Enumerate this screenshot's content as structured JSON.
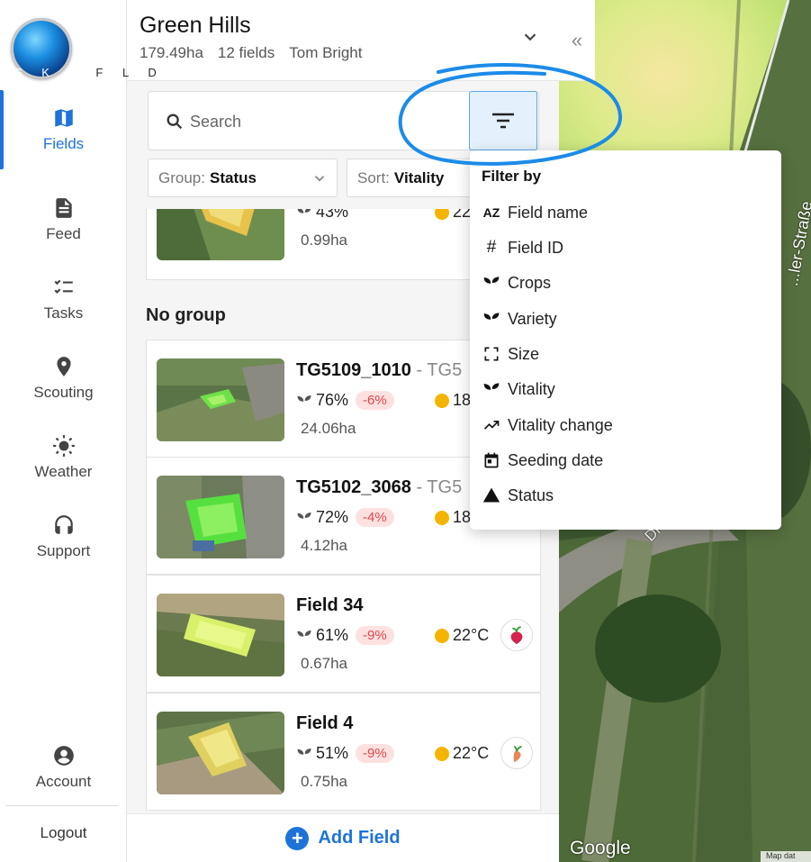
{
  "brand": {
    "logo_text_sky": "S K Y",
    "logo_text_rest": "F L D"
  },
  "nav": {
    "items": [
      {
        "label": "Fields",
        "icon": "map-icon"
      },
      {
        "label": "Feed",
        "icon": "feed-icon"
      },
      {
        "label": "Tasks",
        "icon": "tasks-icon"
      },
      {
        "label": "Scouting",
        "icon": "location-pin-icon"
      },
      {
        "label": "Weather",
        "icon": "sun-icon"
      },
      {
        "label": "Support",
        "icon": "headset-icon"
      }
    ],
    "account": "Account",
    "logout": "Logout"
  },
  "header": {
    "farm_name": "Green Hills",
    "area": "179.49ha",
    "fields_count": "12 fields",
    "owner": "Tom Bright"
  },
  "search": {
    "placeholder": "Search"
  },
  "controls": {
    "group_prefix": "Group:",
    "group_value": "Status",
    "sort_prefix": "Sort:",
    "sort_value": "Vitality"
  },
  "list": {
    "top_partial": {
      "vitality": "43%",
      "temp": "22°",
      "area": "0.99ha"
    },
    "group_label": "No group",
    "fields": [
      {
        "name": "TG5109_1010",
        "sub": " - TG5",
        "vitality": "76%",
        "change": "-6%",
        "temp": "18",
        "area": "24.06ha",
        "crop": ""
      },
      {
        "name": "TG5102_3068",
        "sub": " - TG5",
        "vitality": "72%",
        "change": "-4%",
        "temp": "18",
        "area": "4.12ha",
        "crop": ""
      },
      {
        "name": "Field 34",
        "sub": "",
        "vitality": "61%",
        "change": "-9%",
        "temp": "22°C",
        "area": "0.67ha",
        "crop": "beet-icon"
      },
      {
        "name": "Field 4",
        "sub": "",
        "vitality": "51%",
        "change": "-9%",
        "temp": "22°C",
        "area": "0.75ha",
        "crop": "carrot-icon"
      }
    ]
  },
  "add_field": "Add Field",
  "map": {
    "street1": "...ler-Straße",
    "street2": "Dr",
    "attribution": "Google",
    "data_label": "Map dat"
  },
  "filter_popup": {
    "title": "Filter by",
    "options": [
      {
        "label": "Field name",
        "icon": "az-icon"
      },
      {
        "label": "Field ID",
        "icon": "hash-icon"
      },
      {
        "label": "Crops",
        "icon": "sprout-icon"
      },
      {
        "label": "Variety",
        "icon": "sprout-icon"
      },
      {
        "label": "Size",
        "icon": "expand-icon"
      },
      {
        "label": "Vitality",
        "icon": "sprout-icon"
      },
      {
        "label": "Vitality change",
        "icon": "trending-up-icon"
      },
      {
        "label": "Seeding date",
        "icon": "calendar-icon"
      },
      {
        "label": "Status",
        "icon": "warning-icon"
      }
    ]
  },
  "colors": {
    "accent": "#1e73d9",
    "negative": "#e04848",
    "sun": "#f5b400"
  }
}
